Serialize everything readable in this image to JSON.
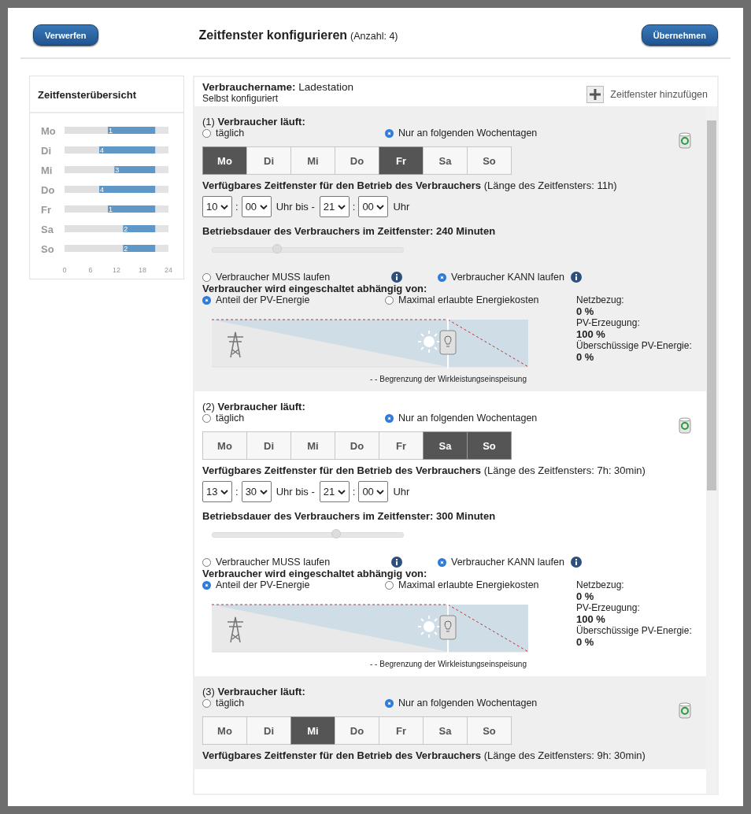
{
  "header": {
    "discard_button": "Verwerfen",
    "title": "Zeitfenster konfigurieren",
    "count": "(Anzahl: 4)",
    "apply_button": "Übernehmen"
  },
  "overview": {
    "title": "Zeitfensterübersicht",
    "chart_data": {
      "type": "bar",
      "orientation": "horizontal",
      "stacked": true,
      "categories": [
        "Mo",
        "Di",
        "Mi",
        "Do",
        "Fr",
        "Sa",
        "So"
      ],
      "xlim": [
        0,
        24
      ],
      "xticks": [
        0,
        6,
        12,
        18,
        24
      ],
      "series": [
        {
          "color": "#e0e0e0",
          "values": [
            10,
            8,
            11.5,
            8,
            10,
            13.5,
            13.5
          ]
        },
        {
          "color": "#5f97c7",
          "values": [
            11,
            13,
            9.5,
            13,
            11,
            7.5,
            7.5
          ]
        }
      ],
      "value_labels": [
        "1",
        "4",
        "3",
        "4",
        "1",
        "2",
        "2"
      ]
    }
  },
  "consumer": {
    "name_label": "Verbrauchername:",
    "name": "Ladestation",
    "subtitle": "Selbst konfiguriert",
    "add_button": "Zeitfenster hinzufügen"
  },
  "windows": [
    {
      "number": "(1)",
      "title": "Verbraucher läuft:",
      "daily": {
        "label": "täglich",
        "selected": false
      },
      "weekdays_option": {
        "label": "Nur an folgenden Wochentagen",
        "selected": true
      },
      "days": [
        {
          "label": "Mo",
          "selected": true
        },
        {
          "label": "Di",
          "selected": false
        },
        {
          "label": "Mi",
          "selected": false
        },
        {
          "label": "Do",
          "selected": false
        },
        {
          "label": "Fr",
          "selected": true
        },
        {
          "label": "Sa",
          "selected": false
        },
        {
          "label": "So",
          "selected": false
        }
      ],
      "window_label": "Verfügbares Zeitfenster für den Betrieb des Verbrauchers",
      "window_length": "(Länge des Zeitfensters: 11h)",
      "from_hour": "10",
      "from_separator": ":",
      "from_minute": "00",
      "until_text": "Uhr bis -",
      "to_hour": "21",
      "to_separator": ":",
      "to_minute": "00",
      "uhr_text": "Uhr",
      "duration_label": "Betriebsdauer des Verbrauchers im Zeitfenster: 240 Minuten",
      "duration": {
        "level": 0.34
      },
      "must_run": {
        "label": "Verbraucher MUSS laufen",
        "selected": false
      },
      "can_run": {
        "label": "Verbraucher KANN laufen",
        "selected": true
      },
      "switch_label": "Verbraucher wird eingeschaltet abhängig von:",
      "pv_share": {
        "label": "Anteil der PV-Energie",
        "selected": true
      },
      "max_cost": {
        "label": "Maximal erlaubte Energiekosten",
        "selected": false
      },
      "stats": [
        {
          "label": "Netzbezug:",
          "value": "0 %"
        },
        {
          "label": "PV-Erzeugung:",
          "value": "100 %"
        },
        {
          "label": "Überschüssige PV-Energie:",
          "value": "0 %"
        }
      ],
      "legend": "- - Begrenzung der Wirkleistungseinspeisung"
    },
    {
      "number": "(2)",
      "title": "Verbraucher läuft:",
      "daily": {
        "label": "täglich",
        "selected": false
      },
      "weekdays_option": {
        "label": "Nur an folgenden Wochentagen",
        "selected": true
      },
      "days": [
        {
          "label": "Mo",
          "selected": false
        },
        {
          "label": "Di",
          "selected": false
        },
        {
          "label": "Mi",
          "selected": false
        },
        {
          "label": "Do",
          "selected": false
        },
        {
          "label": "Fr",
          "selected": false
        },
        {
          "label": "Sa",
          "selected": true
        },
        {
          "label": "So",
          "selected": true
        }
      ],
      "window_label": "Verfügbares Zeitfenster für den Betrieb des Verbrauchers",
      "window_length": "(Länge des Zeitfensters: 7h: 30min)",
      "from_hour": "13",
      "from_separator": ":",
      "from_minute": "30",
      "until_text": "Uhr bis -",
      "to_hour": "21",
      "to_separator": ":",
      "to_minute": "00",
      "uhr_text": "Uhr",
      "duration_label": "Betriebsdauer des Verbrauchers im Zeitfenster: 300 Minuten",
      "duration": {
        "level": 0.65
      },
      "must_run": {
        "label": "Verbraucher MUSS laufen",
        "selected": false
      },
      "can_run": {
        "label": "Verbraucher KANN laufen",
        "selected": true
      },
      "switch_label": "Verbraucher wird eingeschaltet abhängig von:",
      "pv_share": {
        "label": "Anteil der PV-Energie",
        "selected": true
      },
      "max_cost": {
        "label": "Maximal erlaubte Energiekosten",
        "selected": false
      },
      "stats": [
        {
          "label": "Netzbezug:",
          "value": "0 %"
        },
        {
          "label": "PV-Erzeugung:",
          "value": "100 %"
        },
        {
          "label": "Überschüssige PV-Energie:",
          "value": "0 %"
        }
      ],
      "legend": "- - Begrenzung der Wirkleistungseinspeisung"
    },
    {
      "number": "(3)",
      "title": "Verbraucher läuft:",
      "daily": {
        "label": "täglich",
        "selected": false
      },
      "weekdays_option": {
        "label": "Nur an folgenden Wochentagen",
        "selected": true
      },
      "days": [
        {
          "label": "Mo",
          "selected": false
        },
        {
          "label": "Di",
          "selected": false
        },
        {
          "label": "Mi",
          "selected": true
        },
        {
          "label": "Do",
          "selected": false
        },
        {
          "label": "Fr",
          "selected": false
        },
        {
          "label": "Sa",
          "selected": false
        },
        {
          "label": "So",
          "selected": false
        }
      ],
      "window_label": "Verfügbares Zeitfenster für den Betrieb des Verbrauchers",
      "window_length": "(Länge des Zeitfensters: 9h: 30min)"
    }
  ]
}
